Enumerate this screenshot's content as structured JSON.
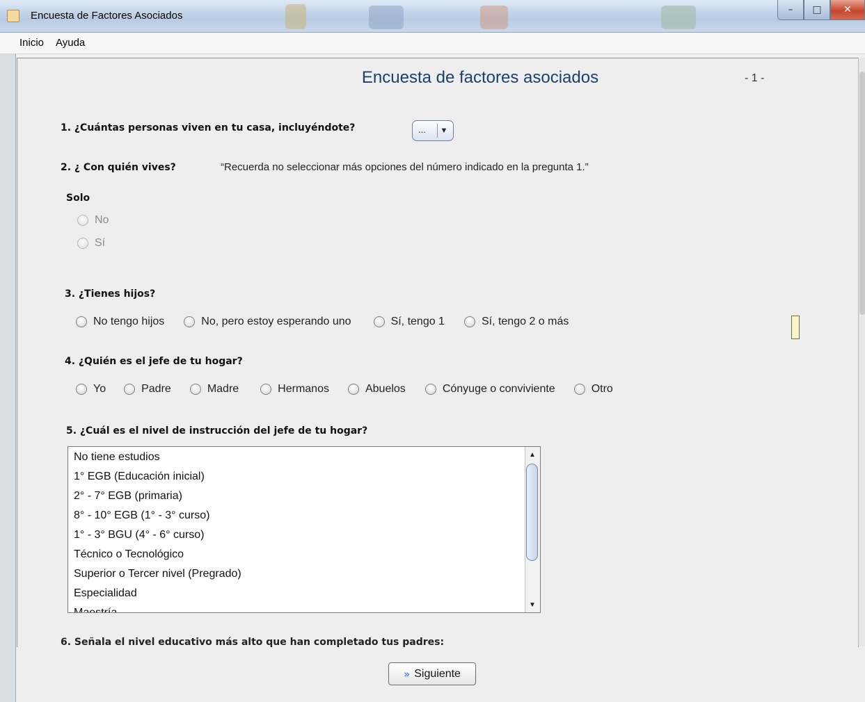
{
  "window": {
    "title": "Encuesta de Factores Asociados",
    "controls": {
      "minimize": "–",
      "maximize": "□",
      "close": "✕"
    }
  },
  "menu": {
    "items": [
      "Inicio",
      "Ayuda"
    ]
  },
  "survey": {
    "heading": "Encuesta de factores asociados",
    "page": "- 1 -",
    "q1": {
      "label": "1. ¿Cuántas personas viven en tu casa, incluyéndote?",
      "combo_value": "...",
      "combo_arrow": "▼"
    },
    "q2": {
      "label": "2. ¿ Con quién vives?",
      "note": "“Recuerda no seleccionar más opciones del número indicado en la pregunta 1.”",
      "group": "Solo",
      "options": [
        "No",
        "Sí"
      ]
    },
    "q3": {
      "label": "3. ¿Tienes hijos?",
      "options": [
        "No tengo hijos",
        "No, pero estoy esperando uno",
        "Sí, tengo 1",
        "Sí, tengo 2 o más"
      ]
    },
    "q4": {
      "label": "4. ¿Quién es el jefe de tu hogar?",
      "options": [
        "Yo",
        "Padre",
        "Madre",
        "Hermanos",
        "Abuelos",
        "Cónyuge o conviviente",
        "Otro"
      ]
    },
    "q5": {
      "label": "5. ¿Cuál es el nivel de instrucción del jefe de tu hogar?",
      "options": [
        "No tiene estudios",
        "1° EGB (Educación inicial)",
        "2° - 7° EGB (primaria)",
        "8° - 10° EGB (1° - 3° curso)",
        "1° - 3° BGU (4° - 6° curso)",
        "Técnico o Tecnológico",
        "Superior o Tercer nivel (Pregrado)",
        "Especialidad",
        "Maestría"
      ]
    },
    "q6_partial": "6. Señala el nivel educativo más alto que han completado tus padres:"
  },
  "footer": {
    "next_label": "Siguiente",
    "next_icon": "»"
  }
}
